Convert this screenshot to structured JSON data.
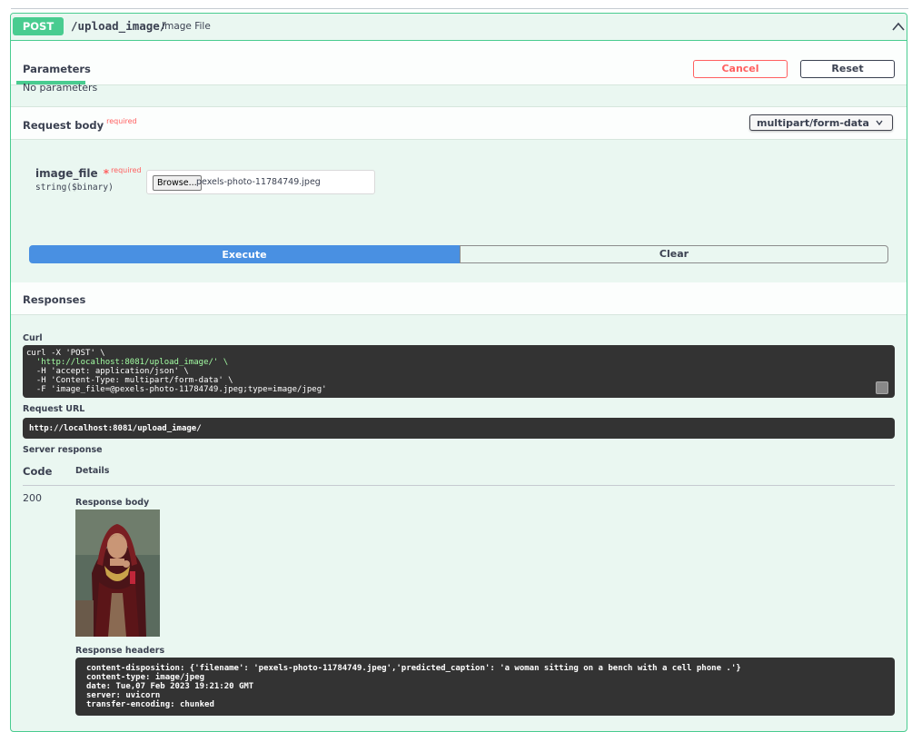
{
  "operation": {
    "method": "POST",
    "path": "/upload_image/",
    "summary": "Image File"
  },
  "params": {
    "tab_label": "Parameters",
    "cancel_label": "Cancel",
    "reset_label": "Reset",
    "none_text": "No parameters"
  },
  "request_body": {
    "title": "Request body",
    "required_label": "required",
    "content_type": "multipart/form-data",
    "field": {
      "name": "image_file",
      "star": "*",
      "required_label": "required",
      "type": "string($binary)",
      "browse_label": "Browse...",
      "file_name": "pexels-photo-11784749.jpeg"
    }
  },
  "actions": {
    "execute_label": "Execute",
    "clear_label": "Clear"
  },
  "responses": {
    "title": "Responses",
    "curl_label": "Curl",
    "curl_lines": [
      "curl -X 'POST' \\",
      "  'http://localhost:8081/upload_image/' \\",
      "  -H 'accept: application/json' \\",
      "  -H 'Content-Type: multipart/form-data' \\",
      "  -F 'image_file=@pexels-photo-11784749.jpeg;type=image/jpeg'"
    ],
    "request_url_label": "Request URL",
    "request_url": "http://localhost:8081/upload_image/",
    "server_response_label": "Server response",
    "code_header": "Code",
    "details_header": "Details",
    "code": "200",
    "response_body_label": "Response body",
    "response_headers_label": "Response headers",
    "headers_lines": [
      "content-disposition: {'filename': 'pexels-photo-11784749.jpeg','predicted_caption': 'a woman sitting on a bench with a cell phone .'}",
      "content-type: image/jpeg",
      "date: Tue,07 Feb 2023 19:21:20 GMT",
      "server: uvicorn",
      "transfer-encoding: chunked"
    ]
  },
  "colors": {
    "accent": "#49cc90",
    "execute": "#4990e2",
    "cancel": "#ff6060",
    "code_bg": "#333333"
  },
  "icons": [
    "chevron-up-icon",
    "chevron-down-icon",
    "copy-icon"
  ]
}
